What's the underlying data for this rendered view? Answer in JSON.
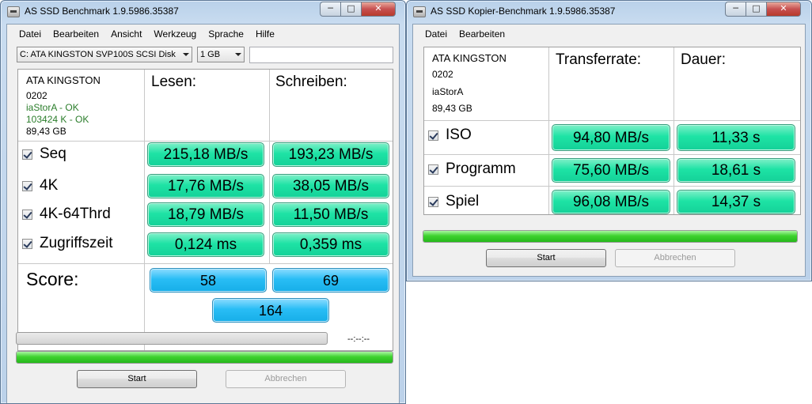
{
  "win1": {
    "title": "AS SSD Benchmark 1.9.5986.35387",
    "controls": {
      "minimize": "─",
      "maximize": "□",
      "close": "✕"
    },
    "menu": [
      "Datei",
      "Bearbeiten",
      "Ansicht",
      "Werkzeug",
      "Sprache",
      "Hilfe"
    ],
    "drive_select": "C: ATA KINGSTON SVP100S SCSI Disk",
    "size_select": "1 GB",
    "drive_info": {
      "model": "ATA KINGSTON",
      "firmware": "0202",
      "driver": "iaStorA - OK",
      "alignment": "103424 K - OK",
      "capacity": "89,43 GB"
    },
    "col_read": "Lesen:",
    "col_write": "Schreiben:",
    "rows": [
      {
        "label": "Seq",
        "read": "215,18 MB/s",
        "write": "193,23 MB/s"
      },
      {
        "label": "4K",
        "read": "17,76 MB/s",
        "write": "38,05 MB/s"
      },
      {
        "label": "4K-64Thrd",
        "read": "18,79 MB/s",
        "write": "11,50 MB/s"
      },
      {
        "label": "Zugriffszeit",
        "read": "0,124 ms",
        "write": "0,359 ms"
      }
    ],
    "score_label": "Score:",
    "score_read": "58",
    "score_write": "69",
    "score_total": "164",
    "time": "--:--:--",
    "progress_top": 0,
    "progress_bottom": 1.0,
    "start": "Start",
    "cancel": "Abbrechen"
  },
  "win2": {
    "title": "AS SSD Kopier-Benchmark 1.9.5986.35387",
    "controls": {
      "minimize": "─",
      "maximize": "□",
      "close": "✕"
    },
    "menu": [
      "Datei",
      "Bearbeiten"
    ],
    "drive_info": {
      "model": "ATA KINGSTON",
      "firmware": "0202",
      "driver": "iaStorA",
      "capacity": "89,43 GB"
    },
    "col_rate": "Transferrate:",
    "col_duration": "Dauer:",
    "rows": [
      {
        "label": "ISO",
        "rate": "94,80 MB/s",
        "duration": "11,33 s"
      },
      {
        "label": "Programm",
        "rate": "75,60 MB/s",
        "duration": "18,61 s"
      },
      {
        "label": "Spiel",
        "rate": "96,08 MB/s",
        "duration": "14,37 s"
      }
    ],
    "progress": 1.0,
    "start": "Start",
    "cancel": "Abbrechen"
  }
}
